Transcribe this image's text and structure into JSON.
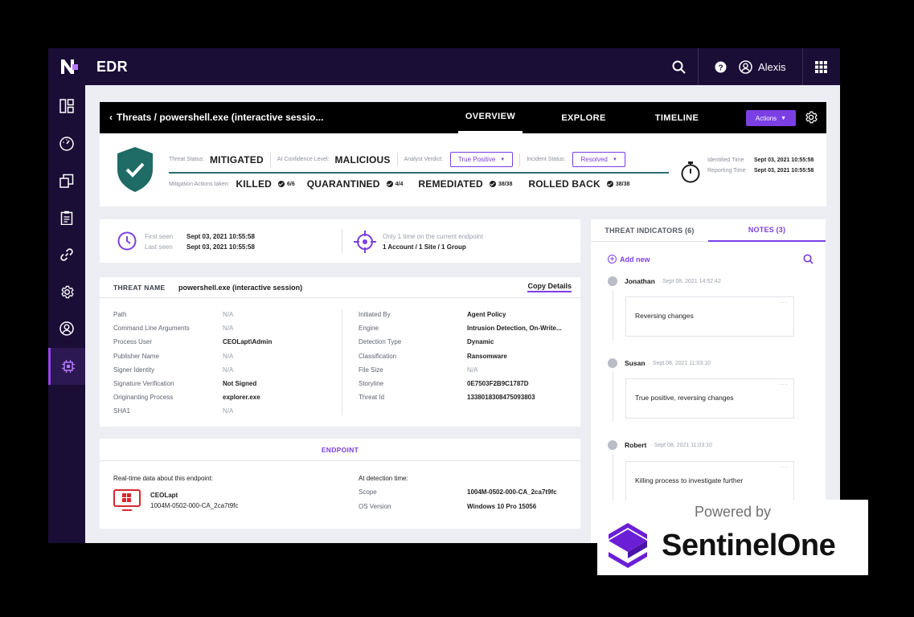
{
  "app": {
    "title": "EDR",
    "user": "Alexis"
  },
  "threat": {
    "breadcrumb": "Threats / powershell.exe (interactive sessio...",
    "tabs": [
      "OVERVIEW",
      "EXPLORE",
      "TIMELINE"
    ],
    "actions_label": "Actions"
  },
  "status": {
    "threat_status_label": "Threat Status:",
    "threat_status": "MITIGATED",
    "ai_label": "AI Confidence Level:",
    "ai_value": "MALICIOUS",
    "verdict_label": "Analyst Verdict:",
    "verdict_value": "True Positive",
    "incident_label": "Incident Status:",
    "incident_value": "Resolved",
    "mitigation_label": "Mitigation Actions taken:",
    "actions": [
      {
        "name": "KILLED",
        "count": "6/6"
      },
      {
        "name": "QUARANTINED",
        "count": "4/4"
      },
      {
        "name": "REMEDIATED",
        "count": "38/38"
      },
      {
        "name": "ROLLED BACK",
        "count": "38/38"
      }
    ],
    "identified_label": "Identified Time",
    "identified_value": "Sept 03, 2021 10:55:58",
    "reporting_label": "Reporting Time",
    "reporting_value": "Sept 03, 2021 10:55:58"
  },
  "seen": {
    "first_label": "First seen",
    "first_value": "Sept 03, 2021 10:55:58",
    "last_label": "Last seen",
    "last_value": "Sept 03, 2021 10:55:58",
    "scope_line1": "Only 1 time on the current endpoint",
    "scope_line2": "1 Account / 1 Site / 1 Group"
  },
  "details": {
    "name_label": "THREAT NAME",
    "name_value": "powershell.exe (interactive session)",
    "copy_label": "Copy Details",
    "left": [
      {
        "k": "Path",
        "v": "N/A"
      },
      {
        "k": "Command Line Arguments",
        "v": "N/A"
      },
      {
        "k": "Process User",
        "v": "CEOLapt\\Admin"
      },
      {
        "k": "Publisher Name",
        "v": "N/A"
      },
      {
        "k": "Signer Identity",
        "v": "N/A"
      },
      {
        "k": "Signature Verification",
        "v": "Not Signed"
      },
      {
        "k": "Originanting Process",
        "v": "explorer.exe"
      },
      {
        "k": "SHA1",
        "v": "N/A"
      }
    ],
    "right": [
      {
        "k": "Initiated By",
        "v": "Agent Policy"
      },
      {
        "k": "Engine",
        "v": "Intrusion Detection, On-Write..."
      },
      {
        "k": "Detection Type",
        "v": "Dynamic"
      },
      {
        "k": "Classification",
        "v": "Ransomware"
      },
      {
        "k": "File Size",
        "v": "N/A"
      },
      {
        "k": "Storyline",
        "v": "0E7503F2B9C1787D"
      },
      {
        "k": "Threat Id",
        "v": "1338018308475093803"
      }
    ]
  },
  "endpoint": {
    "title": "ENDPOINT",
    "realtime_label": "Real-time data about this endpoint:",
    "host_name": "CEOLapt",
    "host_id": "1004M-0502-000-CA_2ca7t9fc",
    "detection_label": "At detection time:",
    "scope_label": "Scope",
    "scope_value": "1004M-0502-000-CA_2ca7t9fc",
    "os_label": "OS Version",
    "os_value": "Windows 10 Pro 15056"
  },
  "notes": {
    "tab_indicators": "THREAT INDICATORS (6)",
    "tab_notes": "NOTES (3)",
    "add_new": "Add new",
    "items": [
      {
        "author": "Jonathan",
        "time": "Sept 08, 2021 14:52:42",
        "text": "Reversing changes"
      },
      {
        "author": "Susan",
        "time": "Sept 08, 2021 11:03:10",
        "text": "True positive, reversing changes"
      },
      {
        "author": "Robert",
        "time": "Sept 08, 2021 11:03:10",
        "text": "Killing process to investigate further"
      }
    ]
  },
  "branding": {
    "powered_by": "Powered by",
    "brand": "SentinelOne"
  },
  "colors": {
    "accent": "#7b3fe4",
    "nav": "#1a0d36",
    "shield": "#1f6b66",
    "endpoint_red": "#d6282f"
  }
}
